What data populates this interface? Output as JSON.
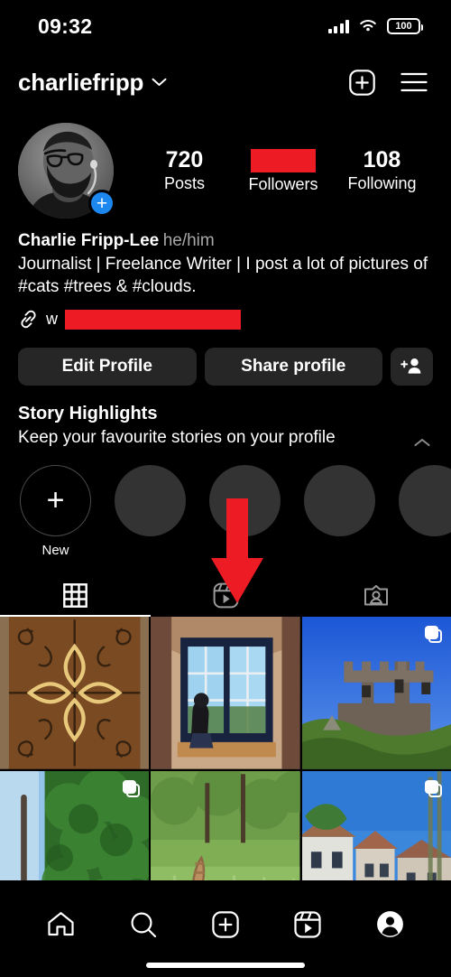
{
  "status_bar": {
    "time": "09:32",
    "battery_level": "100",
    "signal_icon": "cellular-signal-icon",
    "wifi_icon": "wifi-icon",
    "battery_icon": "battery-icon"
  },
  "header": {
    "username": "charliefripp",
    "chevron_icon": "chevron-down-icon",
    "new_post_icon": "plus-square-icon",
    "menu_icon": "hamburger-menu-icon"
  },
  "profile": {
    "avatar_name": "profile-avatar",
    "add_story_badge": "+",
    "stats": [
      {
        "value": "720",
        "label": "Posts",
        "redacted": false
      },
      {
        "value": "",
        "label": "Followers",
        "redacted": true
      },
      {
        "value": "108",
        "label": "Following",
        "redacted": false
      }
    ],
    "display_name": "Charlie Fripp-Lee",
    "pronouns": "he/him",
    "bio": "Journalist | Freelance Writer | I post a lot of pictures of #cats #trees & #clouds.",
    "link_icon": "link-chain-icon",
    "link_visible_prefix": "w",
    "link_redacted": true
  },
  "actions": {
    "edit_profile": "Edit Profile",
    "share_profile": "Share profile",
    "add_person_icon": "add-person-icon"
  },
  "highlights": {
    "title": "Story Highlights",
    "subtitle": "Keep your favourite stories on your profile",
    "collapse_icon": "chevron-up-icon",
    "new_label": "New",
    "new_plus": "+",
    "placeholder_count": 4
  },
  "tabs": [
    {
      "name": "grid-tab",
      "icon": "grid-icon",
      "active": true
    },
    {
      "name": "reels-tab",
      "icon": "reels-icon",
      "active": false
    },
    {
      "name": "tagged-tab",
      "icon": "tagged-person-icon",
      "active": false
    }
  ],
  "grid_posts": [
    {
      "name": "post-ornate-iron-gate",
      "carousel": false
    },
    {
      "name": "post-window-seat",
      "carousel": false
    },
    {
      "name": "post-hilltop-castle",
      "carousel": true
    },
    {
      "name": "post-tall-trees",
      "carousel": true
    },
    {
      "name": "post-cat-in-grass",
      "carousel": false
    },
    {
      "name": "post-village-houses",
      "carousel": true
    }
  ],
  "bottom_nav": [
    {
      "name": "nav-home",
      "icon": "home-icon"
    },
    {
      "name": "nav-search",
      "icon": "search-icon"
    },
    {
      "name": "nav-create",
      "icon": "plus-square-icon"
    },
    {
      "name": "nav-reels",
      "icon": "reels-icon"
    },
    {
      "name": "nav-profile",
      "icon": "profile-avatar-icon"
    }
  ],
  "annotation": {
    "arrow_icon": "red-down-arrow-annotation",
    "color": "#ED1C24"
  },
  "colors": {
    "background": "#000000",
    "button_bg": "#262626",
    "redaction_red": "#ED1C24",
    "muted_text": "#A8A8A8",
    "highlight_circle": "#333333",
    "story_badge_blue": "#1D87F0"
  }
}
